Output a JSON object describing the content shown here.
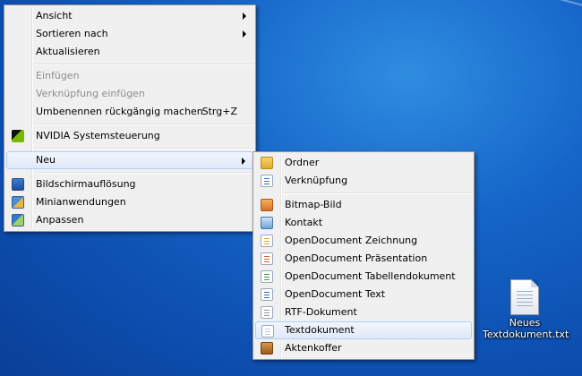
{
  "context_menu": {
    "items": [
      {
        "label": "Ansicht"
      },
      {
        "label": "Sortieren nach"
      },
      {
        "label": "Aktualisieren"
      },
      {
        "label": "Einfügen"
      },
      {
        "label": "Verknüpfung einfügen"
      },
      {
        "label": "Umbenennen rückgängig machen",
        "shortcut": "Strg+Z"
      },
      {
        "label": "NVIDIA Systemsteuerung"
      },
      {
        "label": "Neu"
      },
      {
        "label": "Bildschirmauflösung"
      },
      {
        "label": "Minianwendungen"
      },
      {
        "label": "Anpassen"
      }
    ]
  },
  "submenu_new": {
    "items": [
      {
        "label": "Ordner",
        "icon": "folder-icon"
      },
      {
        "label": "Verknüpfung",
        "icon": "shortcut-icon"
      },
      {
        "label": "Bitmap-Bild",
        "icon": "bitmap-icon"
      },
      {
        "label": "Kontakt",
        "icon": "contact-icon"
      },
      {
        "label": "OpenDocument Zeichnung",
        "icon": "odg-icon"
      },
      {
        "label": "OpenDocument Präsentation",
        "icon": "odp-icon"
      },
      {
        "label": "OpenDocument Tabellendokument",
        "icon": "ods-icon"
      },
      {
        "label": "OpenDocument Text",
        "icon": "odt-icon"
      },
      {
        "label": "RTF-Dokument",
        "icon": "rtf-icon"
      },
      {
        "label": "Textdokument",
        "icon": "text-document-icon"
      },
      {
        "label": "Aktenkoffer",
        "icon": "briefcase-icon"
      }
    ]
  },
  "desktop_icon": {
    "label_line1": "Neues",
    "label_line2": "Textdokument.txt"
  },
  "colors": {
    "desktop": "#1565c8",
    "menu_bg": "#f0f0f0",
    "hover_border": "#aecff7"
  }
}
